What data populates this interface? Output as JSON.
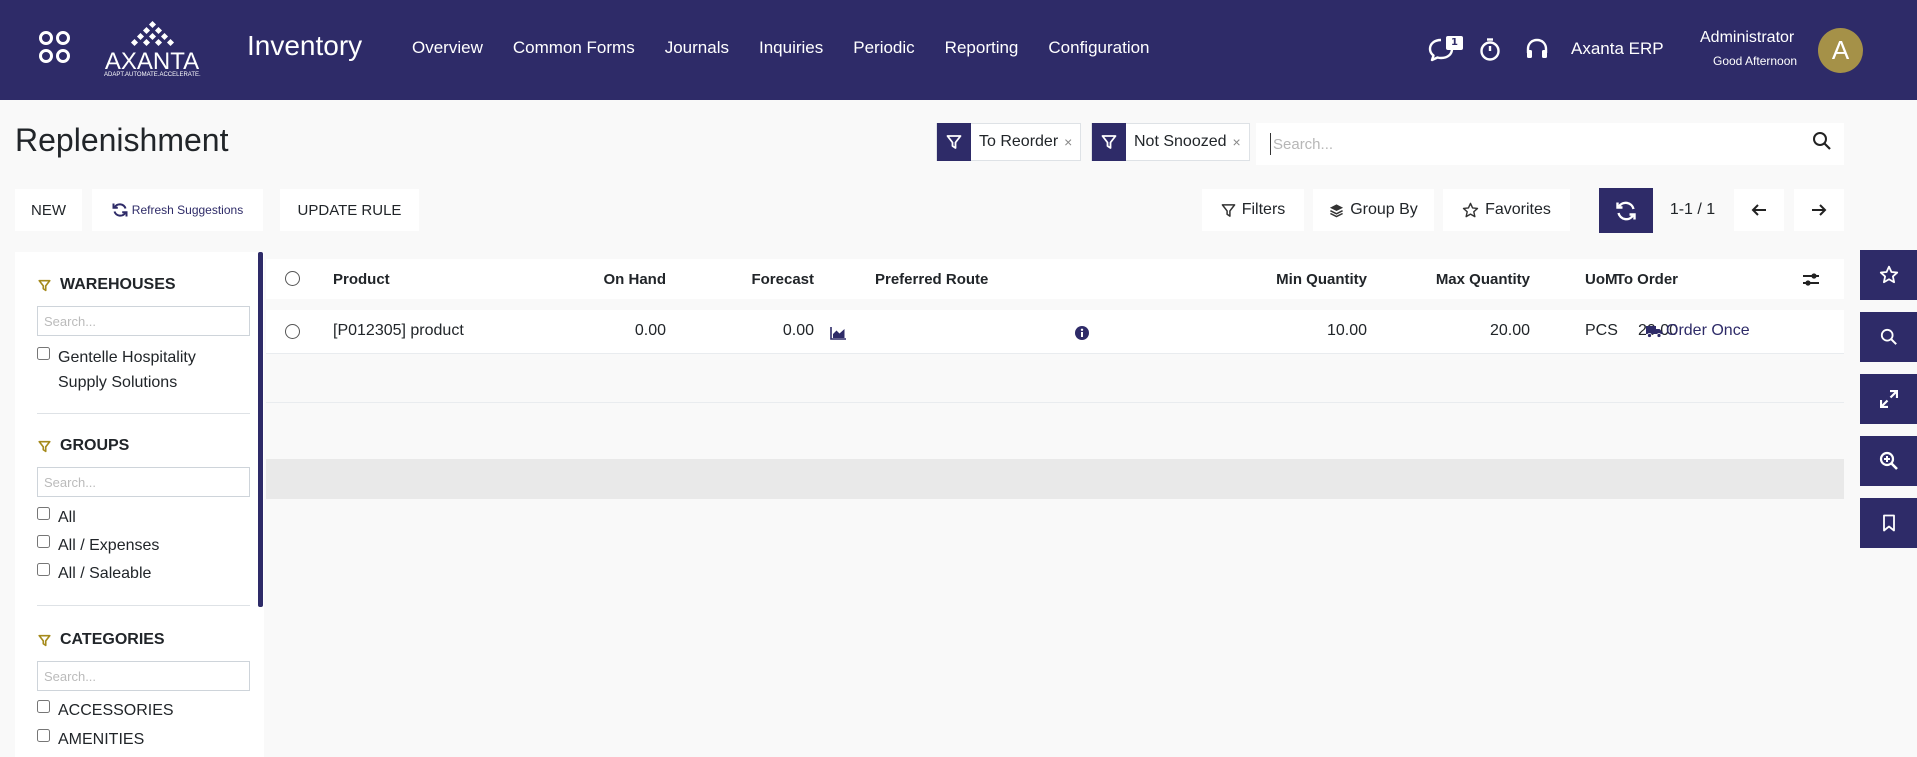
{
  "topbar": {
    "logo_text": "AXANTA",
    "logo_tagline": "ADAPT.AUTOMATE.ACCELERATE.",
    "app_title": "Inventory",
    "nav": [
      "Overview",
      "Common Forms",
      "Journals",
      "Inquiries",
      "Periodic",
      "Reporting",
      "Configuration"
    ],
    "chat_badge": "1",
    "company": "Axanta ERP",
    "user_name": "Administrator",
    "greeting": "Good Afternoon",
    "avatar_letter": "A",
    "icons": [
      "apps-grid-icon",
      "chat-icon",
      "stopwatch-icon",
      "headset-icon"
    ]
  },
  "control": {
    "title": "Replenishment",
    "facets": [
      {
        "label": "To Reorder",
        "remove": "×"
      },
      {
        "label": "Not Snoozed",
        "remove": "×"
      }
    ],
    "search_placeholder": "Search...",
    "new_label": "NEW",
    "refresh_label": "Refresh Suggestions",
    "update_rule_label": "UPDATE RULE",
    "filters_label": "Filters",
    "groupby_label": "Group By",
    "favorites_label": "Favorites",
    "pager": "1-1 / 1"
  },
  "sidepanel": {
    "sections": [
      {
        "title": "WAREHOUSES",
        "search_placeholder": "Search...",
        "items": [
          "Gentelle Hospitality Supply Solutions"
        ]
      },
      {
        "title": "GROUPS",
        "search_placeholder": "Search...",
        "items": [
          "All",
          "All / Expenses",
          "All / Saleable"
        ]
      },
      {
        "title": "CATEGORIES",
        "search_placeholder": "Search...",
        "items": [
          "ACCESSORIES",
          "AMENITIES"
        ]
      }
    ]
  },
  "list": {
    "columns": [
      "Product",
      "On Hand",
      "Forecast",
      "Preferred Route",
      "Min Quantity",
      "Max Quantity",
      "To Order",
      "UoM"
    ],
    "rows": [
      {
        "product": "[P012305] product",
        "on_hand": "0.00",
        "forecast": "0.00",
        "preferred_route": "",
        "min_qty": "10.00",
        "max_qty": "20.00",
        "to_order": "20.00",
        "uom": "PCS",
        "action": "Order Once"
      }
    ]
  },
  "quickbar": {
    "icons": [
      "star-icon",
      "search-icon",
      "expand-icon",
      "zoom-icon",
      "bookmark-icon"
    ]
  },
  "colors": {
    "primary": "#2e2b68",
    "avatar": "#a59148",
    "filter_icon": "#a58a1b",
    "background": "#f9f9f9"
  }
}
